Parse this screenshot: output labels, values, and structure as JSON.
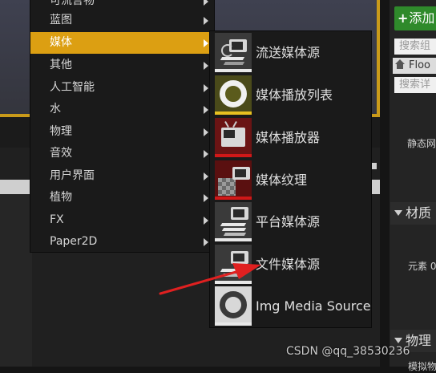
{
  "main_menu": {
    "items": [
      {
        "label": "可流言物",
        "has_submenu": true
      },
      {
        "label": "蓝图",
        "has_submenu": true
      },
      {
        "label": "媒体",
        "has_submenu": true,
        "active": true
      },
      {
        "label": "其他",
        "has_submenu": true
      },
      {
        "label": "人工智能",
        "has_submenu": true
      },
      {
        "label": "水",
        "has_submenu": true
      },
      {
        "label": "物理",
        "has_submenu": true
      },
      {
        "label": "音效",
        "has_submenu": true
      },
      {
        "label": "用户界面",
        "has_submenu": true
      },
      {
        "label": "植物",
        "has_submenu": true
      },
      {
        "label": "FX",
        "has_submenu": true
      },
      {
        "label": "Paper2D",
        "has_submenu": true
      }
    ]
  },
  "media_submenu": {
    "items": [
      {
        "label": "流送媒体源",
        "icon": "stream-media-source-icon",
        "bar_color": "#e8e8e8"
      },
      {
        "label": "媒体播放列表",
        "icon": "media-playlist-icon",
        "bar_color": "#e8c020"
      },
      {
        "label": "媒体播放器",
        "icon": "media-player-icon",
        "bar_color": "#d01818"
      },
      {
        "label": "媒体纹理",
        "icon": "media-texture-icon",
        "bar_color": "#d01818"
      },
      {
        "label": "平台媒体源",
        "icon": "platform-media-source-icon",
        "bar_color": "#e8e8e8"
      },
      {
        "label": "文件媒体源",
        "icon": "file-media-source-icon",
        "bar_color": "#e8e8e8"
      },
      {
        "label": "Img Media Source",
        "icon": "img-media-source-icon",
        "bar_color": "#e8e8e8"
      }
    ]
  },
  "right_panel": {
    "add_button": "添加",
    "search_components_placeholder": "搜索组",
    "component_row": "Floo",
    "search_details_placeholder": "搜索详",
    "static_mesh_label": "静态网",
    "materials_section": "材质",
    "element_label": "元素 0",
    "physics_section": "物理",
    "physics_sub": "模拟物"
  },
  "watermark": "CSDN @qq_38530236",
  "colors": {
    "menu_bg": "#1a1a1a",
    "active_highlight": "#dc9f12",
    "add_button": "#2f8a2b",
    "annotation_arrow": "#e02020"
  }
}
